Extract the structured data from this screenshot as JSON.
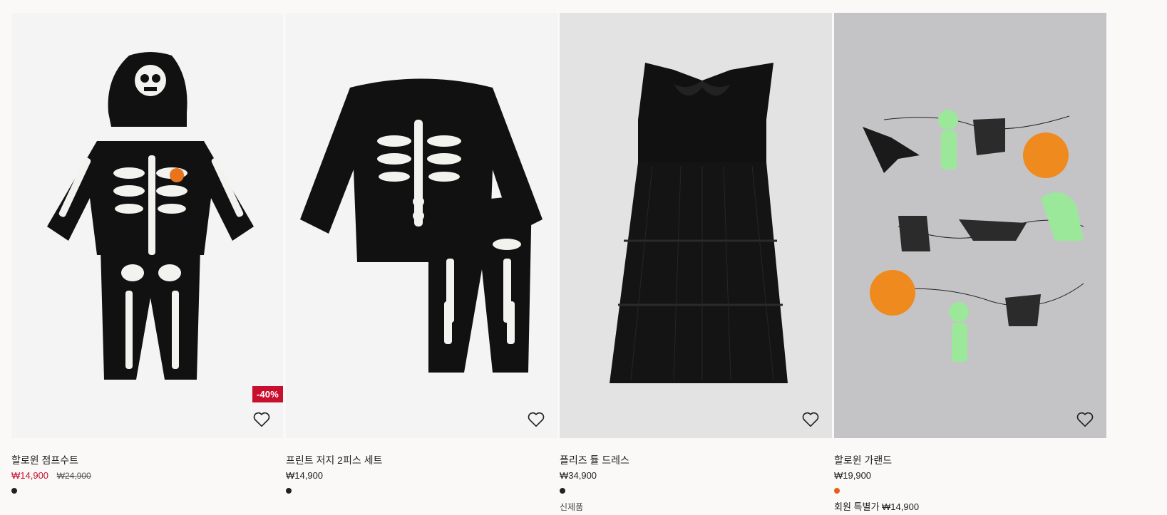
{
  "products": [
    {
      "name": "할로윈 점프수트",
      "price_sale": "₩14,900",
      "price_original": "₩24,900",
      "discount_badge": "-40%",
      "image_bg": "#f4f4f4",
      "swatch_color": "#222222",
      "swatch_icon": "color-swatch",
      "favorite_icon": "heart-outline-icon"
    },
    {
      "name": "프린트 저지 2피스 세트",
      "price": "₩14,900",
      "image_bg": "#f4f4f4",
      "swatch_color": "#222222",
      "favorite_icon": "heart-outline-icon"
    },
    {
      "name": "플리즈 튤 드레스",
      "price": "₩34,900",
      "tag": "신제품",
      "image_bg": "#e3e3e3",
      "swatch_color": "#222222",
      "favorite_icon": "heart-outline-icon"
    },
    {
      "name": "할로윈 가랜드",
      "price": "₩19,900",
      "member_price": "회원 특별가 ₩14,900",
      "image_bg": "#c4c4c6",
      "swatch_color": "#e85d1a",
      "favorite_icon": "heart-outline-icon"
    }
  ]
}
